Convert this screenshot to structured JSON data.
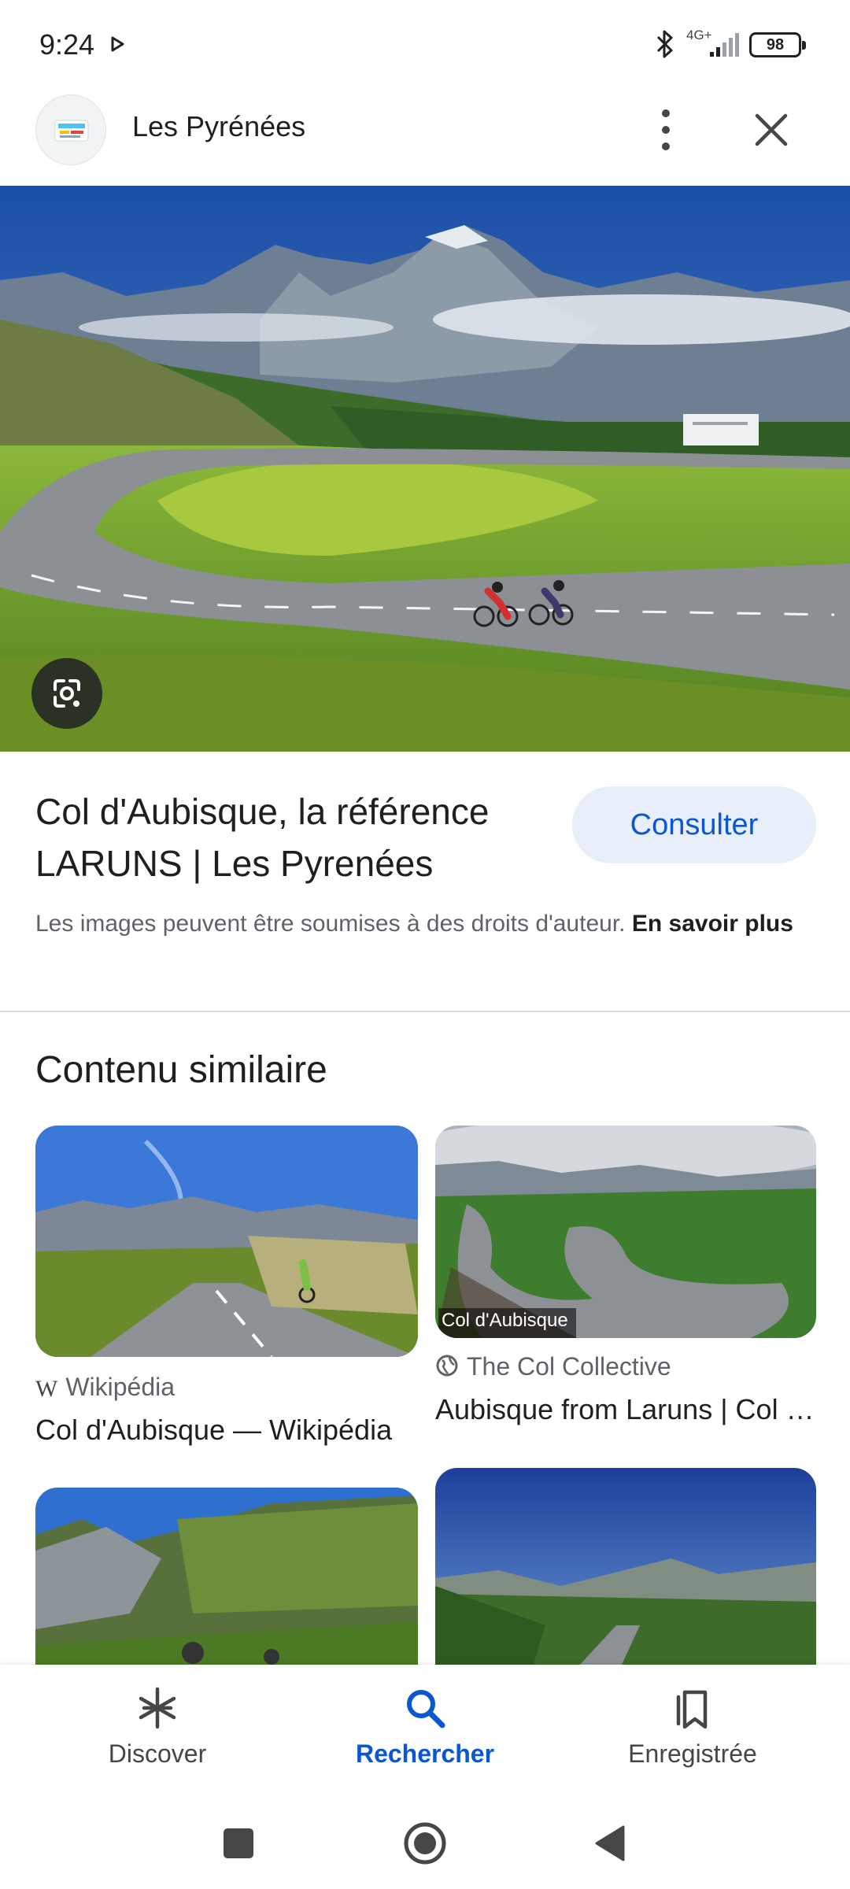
{
  "status_bar": {
    "time": "9:24",
    "network": "4G+",
    "battery": "98"
  },
  "header": {
    "title": "Les Pyrénées"
  },
  "result": {
    "title": "Col d'Aubisque, la référence LARUNS | Les Pyrenées",
    "consult_label": "Consulter",
    "copyright_text": "Les images peuvent être soumises à des droits d'auteur.",
    "learn_more": "En savoir plus"
  },
  "similar": {
    "section_title": "Contenu similaire",
    "cards": [
      {
        "source": "Wikipédia",
        "source_icon": "wikipedia-icon",
        "title": "Col d'Aubisque — Wikipédia"
      },
      {
        "source": "The Col Collective",
        "source_icon": "globe-icon",
        "title": "Aubisque from Laruns | Col Collective",
        "image_caption": "Col d'Aubisque"
      },
      {
        "source": "",
        "title": ""
      },
      {
        "source": "",
        "title": ""
      }
    ]
  },
  "bottom_nav": {
    "items": [
      {
        "label": "Discover",
        "icon": "asterisk-icon",
        "active": false
      },
      {
        "label": "Rechercher",
        "icon": "search-icon",
        "active": true
      },
      {
        "label": "Enregistrée",
        "icon": "bookmarks-icon",
        "active": false
      }
    ]
  },
  "colors": {
    "accent": "#0b57d0",
    "consult_bg": "#e8effa",
    "text_primary": "#1f1f1f",
    "text_secondary": "#5f6368"
  }
}
